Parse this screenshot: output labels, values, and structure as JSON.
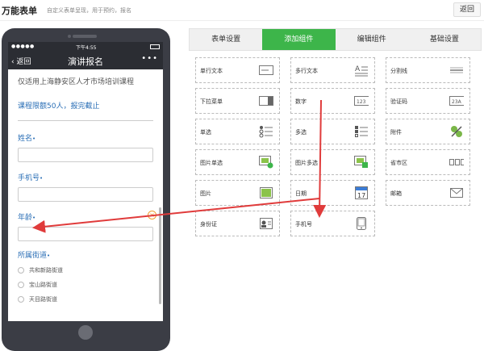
{
  "header": {
    "title": "万能表单",
    "subtitle": "自定义表单呈现，用于预约，报名",
    "back_label": "返回"
  },
  "phone": {
    "status_signal": "●●●●●",
    "status_time": "下午4:55",
    "nav_back": "返回",
    "nav_title": "演讲报名",
    "nav_more": "•••",
    "intro": "仅适用上海静安区人才市场培训课程",
    "limit": "课程限额50人，报完截止",
    "fields": [
      {
        "label": "姓名",
        "req": "•"
      },
      {
        "label": "手机号",
        "req": "•"
      },
      {
        "label": "年龄",
        "req": "•"
      },
      {
        "label": "所属街道",
        "req": "•"
      }
    ],
    "clear_icon": "×",
    "radios": [
      "共和新路街道",
      "宝山路街道",
      "天目路街道"
    ]
  },
  "tabs": [
    {
      "label": "表单设置",
      "active": false
    },
    {
      "label": "添加组件",
      "active": true
    },
    {
      "label": "编辑组件",
      "active": false
    },
    {
      "label": "基础设置",
      "active": false
    }
  ],
  "components": [
    {
      "label": "单行文本",
      "icon": "single-line-text-icon"
    },
    {
      "label": "多行文本",
      "icon": "multi-line-text-icon"
    },
    {
      "label": "分割线",
      "icon": "divider-icon"
    },
    {
      "label": "下拉菜单",
      "icon": "dropdown-icon"
    },
    {
      "label": "数字",
      "icon": "number-icon",
      "glyph": "123"
    },
    {
      "label": "验证码",
      "icon": "captcha-icon",
      "glyph": "23A"
    },
    {
      "label": "单选",
      "icon": "radio-list-icon"
    },
    {
      "label": "多选",
      "icon": "checkbox-list-icon"
    },
    {
      "label": "附件",
      "icon": "attachment-icon"
    },
    {
      "label": "图片单选",
      "icon": "image-radio-icon"
    },
    {
      "label": "图片多选",
      "icon": "image-checkbox-icon"
    },
    {
      "label": "省市区",
      "icon": "region-select-icon"
    },
    {
      "label": "图片",
      "icon": "image-icon"
    },
    {
      "label": "日期",
      "icon": "calendar-icon",
      "glyph": "17"
    },
    {
      "label": "邮箱",
      "icon": "mail-icon"
    },
    {
      "label": "身份证",
      "icon": "id-card-icon"
    },
    {
      "label": "手机号",
      "icon": "mobile-phone-icon"
    }
  ],
  "colors": {
    "accent": "#3db54a",
    "link": "#2b6fb6",
    "arrow": "#e03b3b",
    "dark": "#2b2d33"
  }
}
